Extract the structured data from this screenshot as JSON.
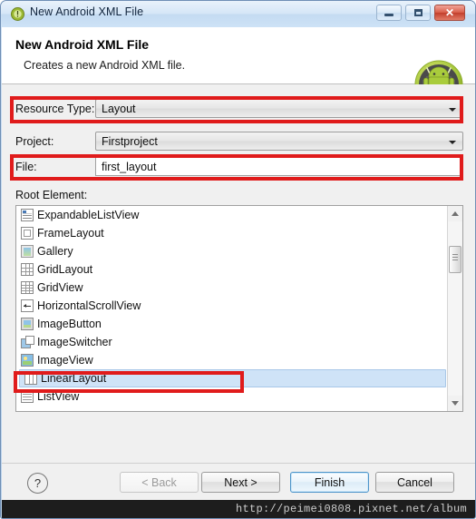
{
  "window": {
    "title": "New Android XML File",
    "title_icon": "android-file-icon",
    "buttons": {
      "minimize": "minimize-icon",
      "maximize": "maximize-icon",
      "close": "✕"
    }
  },
  "header": {
    "title": "New Android XML File",
    "subtitle": "Creates a new Android XML file.",
    "logo": "android-robot-logo"
  },
  "form": {
    "resource_type": {
      "label": "Resource Type:",
      "value": "Layout",
      "highlighted": true
    },
    "project": {
      "label": "Project:",
      "value": "Firstproject",
      "highlighted": false
    },
    "file": {
      "label": "File:",
      "value": "first_layout",
      "placeholder": "",
      "highlighted": true
    },
    "root_element": {
      "label": "Root Element:"
    }
  },
  "root_element_list": {
    "selected": "LinearLayout",
    "items": [
      {
        "label": "ExpandableListView",
        "icon": "expandable-list-view-icon",
        "icon_class": "ico-expandlist"
      },
      {
        "label": "FrameLayout",
        "icon": "frame-layout-icon",
        "icon_class": "ico-frame"
      },
      {
        "label": "Gallery",
        "icon": "gallery-icon",
        "icon_class": "ico-gallery"
      },
      {
        "label": "GridLayout",
        "icon": "grid-layout-icon",
        "icon_class": "ico-gridlayout"
      },
      {
        "label": "GridView",
        "icon": "grid-view-icon",
        "icon_class": "ico-gridview"
      },
      {
        "label": "HorizontalScrollView",
        "icon": "horizontal-scroll-view-icon",
        "icon_class": "ico-hscroll"
      },
      {
        "label": "ImageButton",
        "icon": "image-button-icon",
        "icon_class": "ico-imgbtn"
      },
      {
        "label": "ImageSwitcher",
        "icon": "image-switcher-icon",
        "icon_class": "ico-imgswitch"
      },
      {
        "label": "ImageView",
        "icon": "image-view-icon",
        "icon_class": "ico-imgview"
      },
      {
        "label": "LinearLayout",
        "icon": "linear-layout-icon",
        "icon_class": "ico-linear"
      },
      {
        "label": "ListView",
        "icon": "list-view-icon",
        "icon_class": "ico-listview"
      }
    ]
  },
  "scrollbar": {
    "up_arrow": "scroll-up-icon",
    "down_arrow": "scroll-down-icon",
    "thumb": "scrollbar-thumb"
  },
  "footer": {
    "help": "?",
    "back": "< Back",
    "next": "Next >",
    "finish": "Finish",
    "cancel": "Cancel"
  },
  "watermark": {
    "text": "http://peimei0808.pixnet.net/album"
  },
  "colors": {
    "highlight_red": "#e01b1b",
    "selection_blue": "#cfe3f7",
    "android_green": "#a4c639",
    "titlebar_blue": "#cde2f6"
  }
}
